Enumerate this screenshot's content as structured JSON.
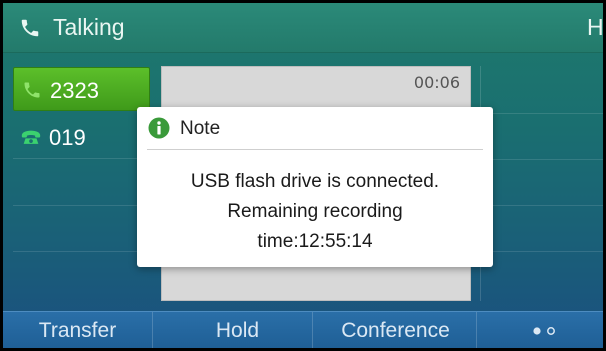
{
  "status_bar": {
    "title": "Talking",
    "right_text": "Hi",
    "icon": "phone-handset-icon"
  },
  "line_keys": [
    {
      "label": "2323",
      "icon": "phone-handset-icon",
      "active": true
    },
    {
      "label": "019",
      "icon": "telephone-icon",
      "active": false
    }
  ],
  "call": {
    "timer": "00:06"
  },
  "dialog": {
    "title": "Note",
    "icon": "info-icon",
    "message_line1": "USB flash drive is connected.",
    "message_line2": "Remaining recording",
    "message_line3": "time:12:55:14"
  },
  "softkeys": [
    {
      "label": "Transfer"
    },
    {
      "label": "Hold"
    },
    {
      "label": "Conference"
    }
  ],
  "more_indicator": "page-dots-icon",
  "colors": {
    "status_bar": "#2b8a79",
    "active_line": "#4fae23",
    "softkey_bar": "#2467a0",
    "dialog_bg": "#ffffff",
    "info_icon": "#3a9a3a"
  }
}
